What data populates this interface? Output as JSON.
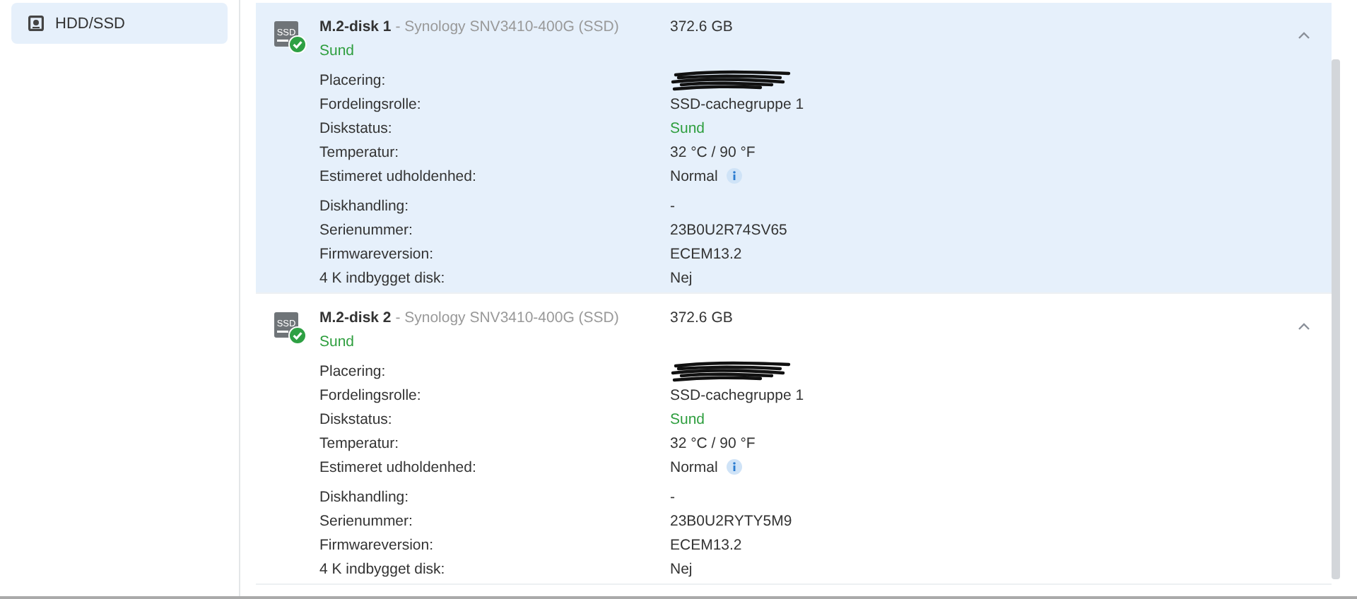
{
  "sidebar": {
    "items": [
      {
        "label": "HDD/SSD",
        "selected": true
      }
    ]
  },
  "disks": [
    {
      "icon_label": "SSD",
      "name": "M.2-disk 1",
      "model": " - Synology SNV3410-400G (SSD)",
      "capacity": "372.6 GB",
      "status": "Sund",
      "selected": true,
      "expanded": true,
      "detail_groups": [
        [
          {
            "label": "Placering:",
            "kind": "redacted"
          },
          {
            "label": "Fordelingsrolle:",
            "kind": "text",
            "value": "SSD-cachegruppe 1"
          },
          {
            "label": "Diskstatus:",
            "kind": "status",
            "value": "Sund"
          },
          {
            "label": "Temperatur:",
            "kind": "text",
            "value": "32 °C / 90 °F"
          },
          {
            "label": "Estimeret udholdenhed:",
            "kind": "info",
            "value": "Normal"
          }
        ],
        [
          {
            "label": "Diskhandling:",
            "kind": "text",
            "value": "-"
          },
          {
            "label": "Serienummer:",
            "kind": "text",
            "value": "23B0U2R74SV65"
          },
          {
            "label": "Firmwareversion:",
            "kind": "text",
            "value": "ECEM13.2"
          },
          {
            "label": "4 K indbygget disk:",
            "kind": "text",
            "value": "Nej"
          }
        ]
      ]
    },
    {
      "icon_label": "SSD",
      "name": "M.2-disk 2",
      "model": " - Synology SNV3410-400G (SSD)",
      "capacity": "372.6 GB",
      "status": "Sund",
      "selected": false,
      "expanded": true,
      "detail_groups": [
        [
          {
            "label": "Placering:",
            "kind": "redacted"
          },
          {
            "label": "Fordelingsrolle:",
            "kind": "text",
            "value": "SSD-cachegruppe 1"
          },
          {
            "label": "Diskstatus:",
            "kind": "status",
            "value": "Sund"
          },
          {
            "label": "Temperatur:",
            "kind": "text",
            "value": "32 °C / 90 °F"
          },
          {
            "label": "Estimeret udholdenhed:",
            "kind": "info",
            "value": "Normal"
          }
        ],
        [
          {
            "label": "Diskhandling:",
            "kind": "text",
            "value": "-"
          },
          {
            "label": "Serienummer:",
            "kind": "text",
            "value": "23B0U2RYTY5M9"
          },
          {
            "label": "Firmwareversion:",
            "kind": "text",
            "value": "ECEM13.2"
          },
          {
            "label": "4 K indbygget disk:",
            "kind": "text",
            "value": "Nej"
          }
        ]
      ]
    }
  ]
}
